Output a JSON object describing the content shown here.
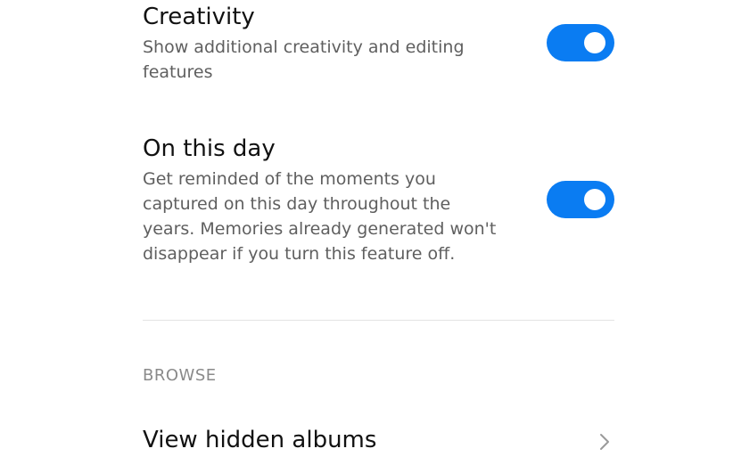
{
  "settings": [
    {
      "title": "Creativity",
      "description": "Show additional creativity and editing features",
      "enabled": true
    },
    {
      "title": "On this day",
      "description": "Get reminded of the moments you captured on this day throughout the years. Memories already generated won't disappear if you turn this feature off.",
      "enabled": true
    }
  ],
  "browse": {
    "header": "BROWSE",
    "items": [
      {
        "label": "View hidden albums",
        "icon": "chevron-right-icon"
      }
    ]
  },
  "colors": {
    "toggle_on": "#0a7cf2",
    "divider": "#e4e4e4",
    "secondary_text": "#5f5f5f",
    "section_header": "#8a8a8a"
  }
}
